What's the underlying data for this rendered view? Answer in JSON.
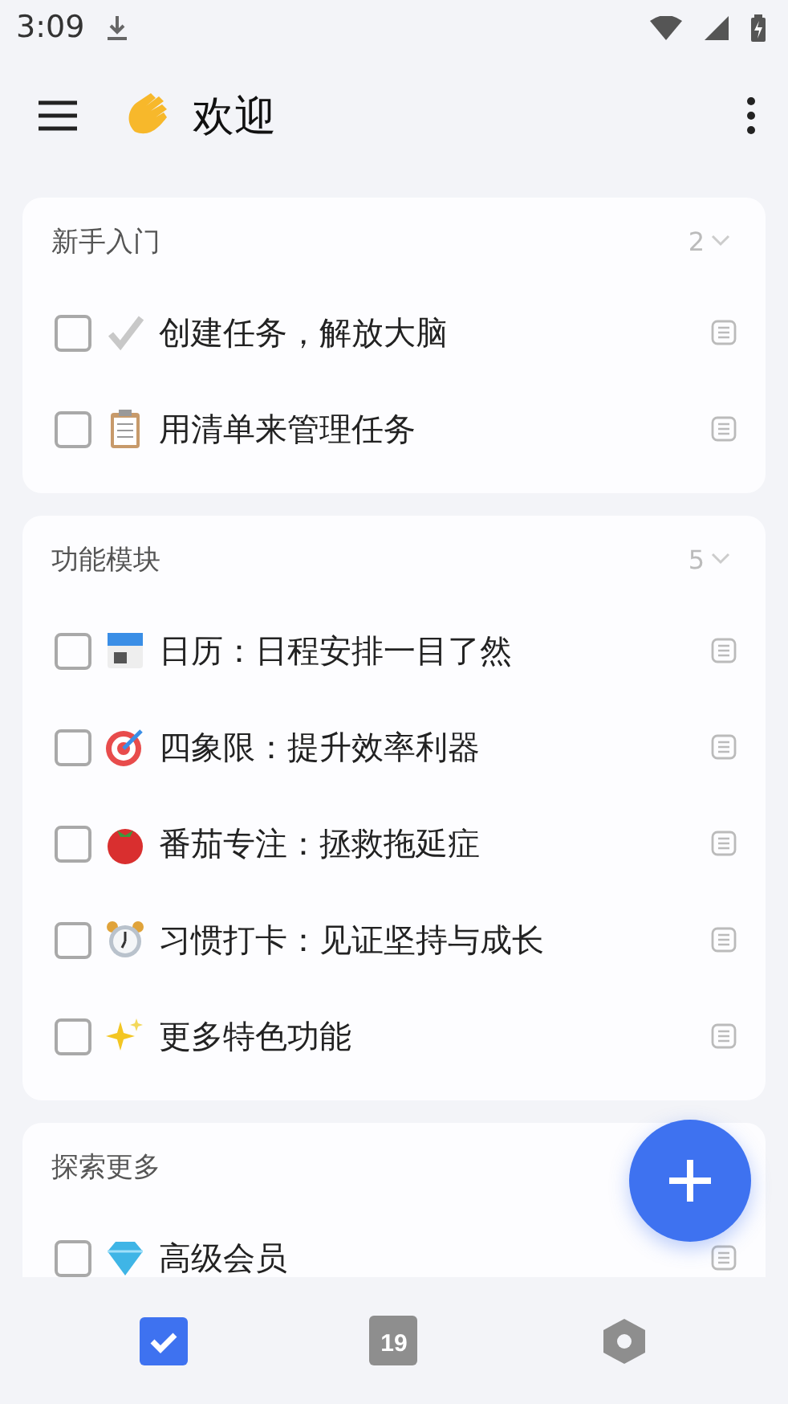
{
  "status_bar": {
    "time": "3:09"
  },
  "app_bar": {
    "title": "欢迎"
  },
  "sections": [
    {
      "title": "新手入门",
      "count": "2",
      "tasks": [
        {
          "kind": "check",
          "text": "创建任务，解放大脑",
          "checked": false
        },
        {
          "kind": "clipboard",
          "text": "用清单来管理任务",
          "checked": false
        }
      ]
    },
    {
      "title": "功能模块",
      "count": "5",
      "tasks": [
        {
          "kind": "calendar",
          "text": "日历：日程安排一目了然",
          "checked": false
        },
        {
          "kind": "target",
          "text": "四象限：提升效率利器",
          "checked": false
        },
        {
          "kind": "tomato",
          "text": "番茄专注：拯救拖延症",
          "checked": false
        },
        {
          "kind": "clock",
          "text": "习惯打卡：见证坚持与成长",
          "checked": false
        },
        {
          "kind": "sparkles",
          "text": "更多特色功能",
          "checked": false
        }
      ]
    },
    {
      "title": "探索更多",
      "tasks": [
        {
          "kind": "gem",
          "text": "高级会员",
          "checked": false
        }
      ]
    }
  ],
  "nav": [
    {
      "kind": "tasks",
      "selected": true
    },
    {
      "kind": "calendar",
      "label": "19",
      "selected": false
    },
    {
      "kind": "settings",
      "selected": false
    }
  ]
}
